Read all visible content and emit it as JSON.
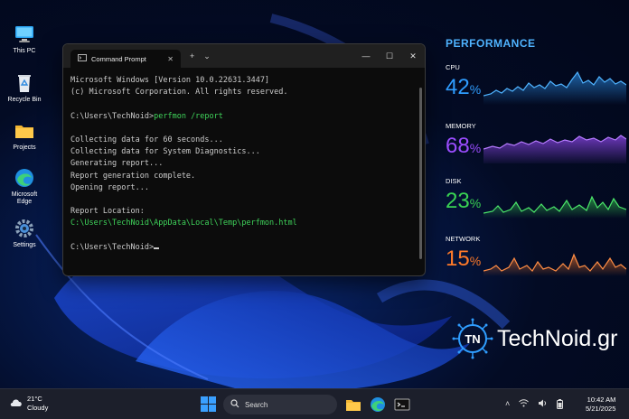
{
  "desktop": {
    "icons": [
      {
        "label": "This PC",
        "icon": "computer-icon"
      },
      {
        "label": "Recycle Bin",
        "icon": "recycle-bin-icon"
      },
      {
        "label": "Projects",
        "icon": "folder-icon"
      },
      {
        "label": "Microsoft Edge",
        "icon": "edge-icon"
      },
      {
        "label": "Settings",
        "icon": "gear-icon"
      }
    ]
  },
  "terminal": {
    "tab_title": "Command Prompt",
    "lines": [
      "Microsoft Windows [Version 10.0.22631.3447]",
      "(c) Microsoft Corporation. All rights reserved.",
      "",
      "C:\\Users\\TechNoid>",
      "",
      "Collecting data for 60 seconds...",
      "Collecting data for System Diagnostics...",
      "Generating report...",
      "Report generation complete.",
      "Opening report...",
      "",
      "Report Location:",
      "C:\\Users\\TechNoid\\AppData\\Local\\Temp\\perfmon.html",
      "",
      "C:\\Users\\TechNoid>"
    ],
    "command": "perfmon /report",
    "accent": "#3fd35a"
  },
  "performance": {
    "title": "PERFORMANCE",
    "metrics": [
      {
        "label": "CPU",
        "value": "42",
        "unit": "%",
        "color": "#2f9dff"
      },
      {
        "label": "MEMORY",
        "value": "68",
        "unit": "%",
        "color": "#9b4dff"
      },
      {
        "label": "DISK",
        "value": "23",
        "unit": "%",
        "color": "#39d353"
      },
      {
        "label": "NETWORK",
        "value": "15",
        "unit": "%",
        "color": "#ff7a29"
      }
    ]
  },
  "brand": {
    "logo_initials": "TN",
    "name": "TechNoid.gr"
  },
  "taskbar": {
    "weather_temp": "21°C",
    "weather_desc": "Cloudy",
    "search_placeholder": "Search",
    "time": "10:42 AM",
    "date": "5/21/2025"
  }
}
